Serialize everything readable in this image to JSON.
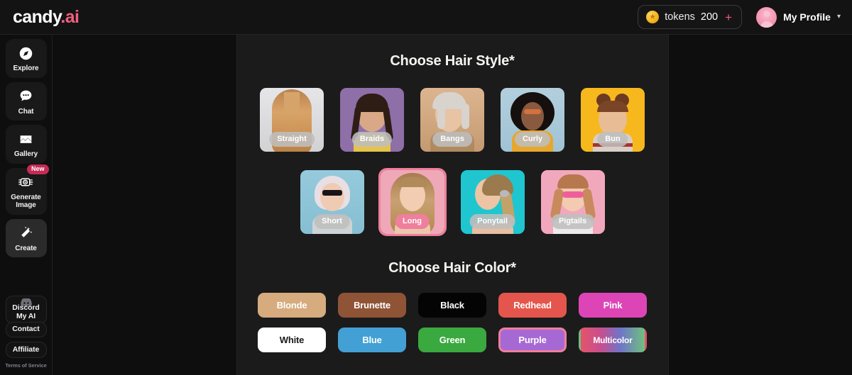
{
  "header": {
    "logo_primary": "candy",
    "logo_accent": ".ai",
    "tokens_label": "tokens",
    "tokens_count": "200",
    "tokens_plus": "+",
    "profile_name": "My Profile",
    "chevron": "⌄",
    "coin_icon": "coin-star-icon",
    "accent_color": "#ef5f7e"
  },
  "sidebar": {
    "items": [
      {
        "label": "Explore",
        "icon": "compass-icon",
        "active": false,
        "badge": null
      },
      {
        "label": "Chat",
        "icon": "chat-bubble-icon",
        "active": false,
        "badge": null
      },
      {
        "label": "Gallery",
        "icon": "gallery-image-icon",
        "active": false,
        "badge": null
      },
      {
        "label": "Generate Image",
        "icon": "camera-icon",
        "active": false,
        "badge": "New"
      },
      {
        "label": "Create",
        "icon": "magic-wand-icon",
        "active": true,
        "badge": null
      }
    ],
    "mini_items": [
      {
        "label": "Discord",
        "icon": "discord-icon"
      },
      {
        "label": "My AI",
        "icon": null
      },
      {
        "label": "Contact",
        "icon": null
      },
      {
        "label": "Affiliate",
        "icon": null
      }
    ],
    "terms": "Terms of Service"
  },
  "main": {
    "hair_style": {
      "title": "Choose Hair Style*",
      "rows": [
        [
          {
            "label": "Straight",
            "selected": false,
            "bg": "#d9d9db"
          },
          {
            "label": "Braids",
            "selected": false,
            "bg": "#8e6fa8"
          },
          {
            "label": "Bangs",
            "selected": false,
            "bg": "#d3a882"
          },
          {
            "label": "Curly",
            "selected": false,
            "bg": "#a8c8d8"
          },
          {
            "label": "Bun",
            "selected": false,
            "bg": "#f7b81e"
          }
        ],
        [
          {
            "label": "Short",
            "selected": false,
            "bg": "#8ec4d8"
          },
          {
            "label": "Long",
            "selected": true,
            "bg": "#efa8b8"
          },
          {
            "label": "Ponytail",
            "selected": false,
            "bg": "#1fc6cf"
          },
          {
            "label": "Pigtails",
            "selected": false,
            "bg": "#f2a8bc"
          }
        ]
      ]
    },
    "hair_color": {
      "title": "Choose Hair Color*",
      "rows": [
        [
          {
            "label": "Blonde",
            "bg": "#d6ab7e",
            "fg": "#ffffff",
            "selected": false
          },
          {
            "label": "Brunette",
            "bg": "#8f5336",
            "fg": "#ffffff",
            "selected": false
          },
          {
            "label": "Black",
            "bg": "#040404",
            "fg": "#ffffff",
            "selected": false
          },
          {
            "label": "Redhead",
            "bg": "#e4564d",
            "fg": "#ffffff",
            "selected": false
          },
          {
            "label": "Pink",
            "bg": "#dd45b7",
            "fg": "#ffffff",
            "selected": false
          }
        ],
        [
          {
            "label": "White",
            "bg": "#ffffff",
            "fg": "#1a1a1a",
            "selected": false
          },
          {
            "label": "Blue",
            "bg": "#42a0d4",
            "fg": "#ffffff",
            "selected": false
          },
          {
            "label": "Green",
            "bg": "#3aa93f",
            "fg": "#ffffff",
            "selected": false
          },
          {
            "label": "Purple",
            "bg": "#a669d4",
            "fg": "#ffffff",
            "selected": true
          },
          {
            "label": "Multicolor",
            "bg": "linear-gradient(90deg,#e4546b 0%,#c74f8f 32%,#6f74c9 62%,#6fc17e 100%)",
            "fg": "#ffffff",
            "selected": false
          }
        ]
      ]
    }
  }
}
